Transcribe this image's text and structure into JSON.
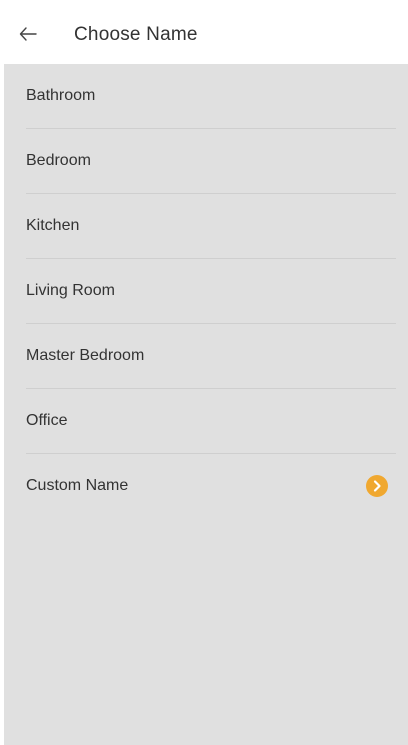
{
  "header": {
    "title": "Choose Name",
    "back_icon": "arrow-left-icon"
  },
  "rooms": [
    {
      "label": "Bathroom"
    },
    {
      "label": "Bedroom"
    },
    {
      "label": "Kitchen"
    },
    {
      "label": "Living Room"
    },
    {
      "label": "Master Bedroom"
    },
    {
      "label": "Office"
    }
  ],
  "custom": {
    "label": "Custom Name",
    "icon": "chevron-right-circle-icon"
  },
  "colors": {
    "list_background": "#e0e0e0",
    "accent": "#f0a830",
    "divider": "#cfcfcf",
    "text": "#333333"
  }
}
